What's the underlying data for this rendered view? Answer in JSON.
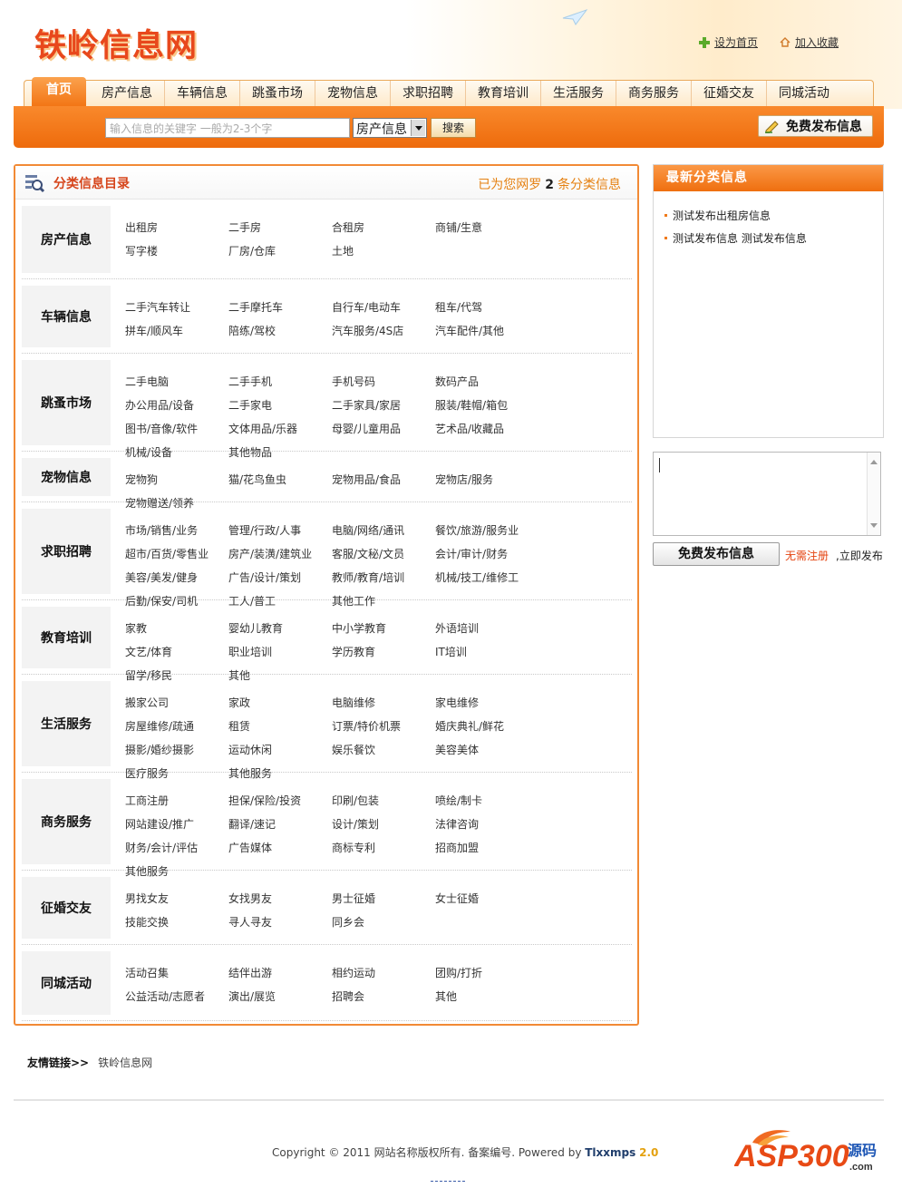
{
  "header": {
    "logo_text": "铁岭信息网",
    "set_home": "设为首页",
    "add_favorite": "加入收藏"
  },
  "nav": [
    "首页",
    "房产信息",
    "车辆信息",
    "跳蚤市场",
    "宠物信息",
    "求职招聘",
    "教育培训",
    "生活服务",
    "商务服务",
    "征婚交友",
    "同城活动"
  ],
  "search": {
    "placeholder": "输入信息的关键字  一般为2-3个字",
    "category": "房产信息",
    "button": "搜索",
    "post_button": "免费发布信息"
  },
  "category_box": {
    "title": "分类信息目录",
    "count_prefix": "已为您网罗",
    "count": "2",
    "count_suffix": "条分类信息",
    "rows": [
      {
        "name": "房产信息",
        "links": [
          "出租房",
          "二手房",
          "合租房",
          "商铺/生意",
          "写字楼",
          "厂房/仓库",
          "土地"
        ]
      },
      {
        "name": "车辆信息",
        "links": [
          "二手汽车转让",
          "二手摩托车",
          "自行车/电动车",
          "租车/代驾",
          "拼车/顺风车",
          "陪练/驾校",
          "汽车服务/4S店",
          "汽车配件/其他"
        ]
      },
      {
        "name": "跳蚤市场",
        "links": [
          "二手电脑",
          "二手手机",
          "手机号码",
          "数码产品",
          "办公用品/设备",
          "二手家电",
          "二手家具/家居",
          "服装/鞋帽/箱包",
          "图书/音像/软件",
          "文体用品/乐器",
          "母婴/儿童用品",
          "艺术品/收藏品",
          "机械/设备",
          "其他物品"
        ]
      },
      {
        "name": "宠物信息",
        "links": [
          "宠物狗",
          "猫/花鸟鱼虫",
          "宠物用品/食品",
          "宠物店/服务",
          "宠物赠送/领养"
        ]
      },
      {
        "name": "求职招聘",
        "links": [
          "市场/销售/业务",
          "管理/行政/人事",
          "电脑/网络/通讯",
          "餐饮/旅游/服务业",
          "超市/百货/零售业",
          "房产/装潢/建筑业",
          "客服/文秘/文员",
          "会计/审计/财务",
          "美容/美发/健身",
          "广告/设计/策划",
          "教师/教育/培训",
          "机械/技工/维修工",
          "后勤/保安/司机",
          "工人/普工",
          "其他工作"
        ]
      },
      {
        "name": "教育培训",
        "links": [
          "家教",
          "婴幼儿教育",
          "中小学教育",
          "外语培训",
          "文艺/体育",
          "职业培训",
          "学历教育",
          "IT培训",
          "留学/移民",
          "其他"
        ]
      },
      {
        "name": "生活服务",
        "links": [
          "搬家公司",
          "家政",
          "电脑维修",
          "家电维修",
          "房屋维修/疏通",
          "租赁",
          "订票/特价机票",
          "婚庆典礼/鲜花",
          "摄影/婚纱摄影",
          "运动休闲",
          "娱乐餐饮",
          "美容美体",
          "医疗服务",
          "其他服务"
        ]
      },
      {
        "name": "商务服务",
        "links": [
          "工商注册",
          "担保/保险/投资",
          "印刷/包装",
          "喷绘/制卡",
          "网站建设/推广",
          "翻译/速记",
          "设计/策划",
          "法律咨询",
          "财务/会计/评估",
          "广告媒体",
          "商标专利",
          "招商加盟",
          "其他服务"
        ]
      },
      {
        "name": "征婚交友",
        "links": [
          "男找女友",
          "女找男友",
          "男士征婚",
          "女士征婚",
          "技能交换",
          "寻人寻友",
          "同乡会"
        ]
      },
      {
        "name": "同城活动",
        "links": [
          "活动召集",
          "结伴出游",
          "相约运动",
          "团购/打折",
          "公益活动/志愿者",
          "演出/展览",
          "招聘会",
          "其他"
        ]
      }
    ]
  },
  "sidebar": {
    "title": "最新分类信息",
    "items": [
      "测试发布出租房信息",
      "测试发布信息 测试发布信息"
    ],
    "quick_button": "免费发布信息",
    "register": "无需注册",
    "post_now": ",立即发布"
  },
  "footer": {
    "friend_label": "友情链接>>",
    "friend_link": "铁岭信息网",
    "copyright": "Copyright © 2011 网站名称版权所有. 备案编号. Powered by ",
    "brand": "Tlxxmps",
    "version": "2.0",
    "asp_logo": "ASP300",
    "asp_logo_suffix": "源码",
    "asp_logo_domain": ".com"
  },
  "colors": {
    "accent": "#f27413",
    "title_red": "#d6451b",
    "count_orange": "#e58112"
  }
}
